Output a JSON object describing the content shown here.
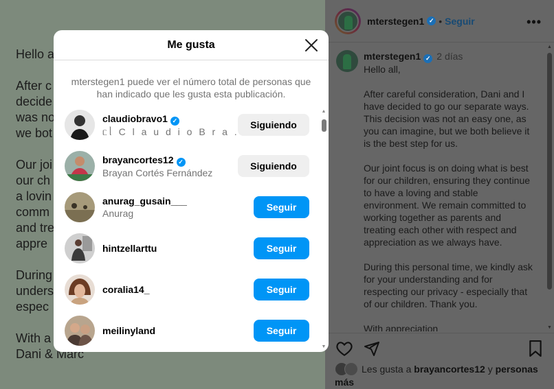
{
  "post_image": {
    "paragraphs": [
      "Hello a",
      "After c\ndecide\nwas no\nwe bot",
      "Our joi\nour ch\na lovin\ncomm\nand tre\nappre",
      "During\nunders\nespec",
      "With a\nDani & Marc"
    ]
  },
  "panel": {
    "header": {
      "username": "mterstegen1",
      "separator": "•",
      "follow_label": "Seguir",
      "more_icon": "more-horizontal-icon"
    },
    "caption": {
      "username": "mterstegen1",
      "time": "2 días",
      "paragraphs": [
        "Hello all,",
        "After careful consideration, Dani and I have decided to go our separate ways. This decision was not an easy one, as you can imagine, but we both believe it is the best step for us.",
        "Our joint focus is on doing what is best for our children, ensuring they continue to have a loving and stable environment. We remain committed to working together as parents and treating each other with respect and appreciation as we always have.",
        "During this personal time, we kindly ask for your understanding and for respecting our privacy - especially that of our children. Thank you.",
        "With appreciation"
      ]
    },
    "actions": {
      "like_icon": "heart-icon",
      "share_icon": "send-icon",
      "save_icon": "bookmark-icon"
    },
    "likes": {
      "prefix": "Les gusta a",
      "user": "brayancortes12",
      "connector": "y",
      "suffix": "personas más"
    }
  },
  "modal": {
    "title": "Me gusta",
    "close_icon": "close-icon",
    "note": "mterstegen1 puede ver el número total de personas que han indicado que les gusta esta publicación.",
    "users": [
      {
        "username": "claudiobravo1",
        "verified": true,
        "full_name": "ᥴᥣ C l a u d i o  B r a ...",
        "button": "Siguiendo",
        "following": true
      },
      {
        "username": "brayancortes12",
        "verified": true,
        "full_name": "Brayan Cortés Fernández",
        "button": "Siguiendo",
        "following": true
      },
      {
        "username": "anurag_gusain___",
        "verified": false,
        "full_name": "Anurag",
        "button": "Seguir",
        "following": false
      },
      {
        "username": "hintzellarttu",
        "verified": false,
        "full_name": "",
        "button": "Seguir",
        "following": false
      },
      {
        "username": "coralia14_",
        "verified": false,
        "full_name": "",
        "button": "Seguir",
        "following": false
      },
      {
        "username": "meilinyland",
        "verified": false,
        "full_name": "",
        "button": "Seguir",
        "following": false
      }
    ]
  },
  "colors": {
    "accent_blue": "#0095f6",
    "following_bg": "#efefef",
    "overlay": "rgba(0,0,0,0.6)"
  }
}
